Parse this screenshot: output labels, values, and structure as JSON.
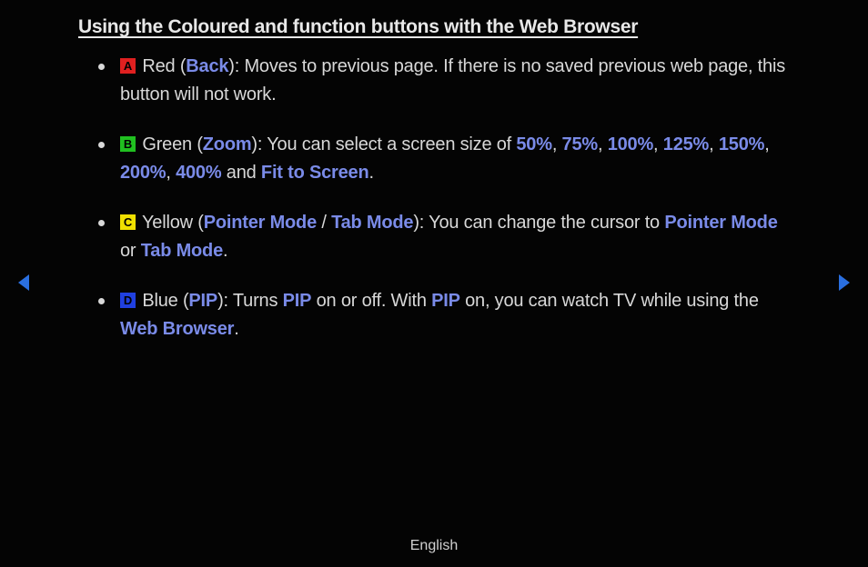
{
  "title": "Using the Coloured and function buttons with the Web Browser",
  "items": [
    {
      "badge": {
        "letter": "A",
        "colorClass": "red"
      },
      "color_label": "Red",
      "paren_hl": "Back",
      "tail": "): Moves to previous page. If there is no saved previous web page, this button will not work."
    },
    {
      "badge": {
        "letter": "B",
        "colorClass": "green"
      },
      "color_label": "Green",
      "paren_hl": "Zoom",
      "zoom_intro": "): You can select a screen size of ",
      "zoom_values": [
        "50%",
        "75%",
        "100%",
        "125%",
        "150%",
        "200%",
        "400%"
      ],
      "zoom_and": " and ",
      "zoom_fit": "Fit to Screen",
      "period": "."
    },
    {
      "badge": {
        "letter": "C",
        "colorClass": "yellow"
      },
      "color_label": "Yellow",
      "paren_hl": "Pointer Mode",
      "slash": " / ",
      "paren_hl2": "Tab Mode",
      "tail_intro": "): You can change the cursor to ",
      "mode1": "Pointer Mode",
      "or": " or ",
      "mode2": "Tab Mode",
      "period": "."
    },
    {
      "badge": {
        "letter": "D",
        "colorClass": "blue"
      },
      "color_label": "Blue",
      "paren_hl": "PIP",
      "pip_a": "): Turns ",
      "pip_hl1": "PIP",
      "pip_b": " on or off. With ",
      "pip_hl2": "PIP",
      "pip_c": " on, you can watch TV while using the ",
      "pip_hl3": "Web Browser",
      "period": "."
    }
  ],
  "footer": "English",
  "arrow_color": "#2a6fe0"
}
